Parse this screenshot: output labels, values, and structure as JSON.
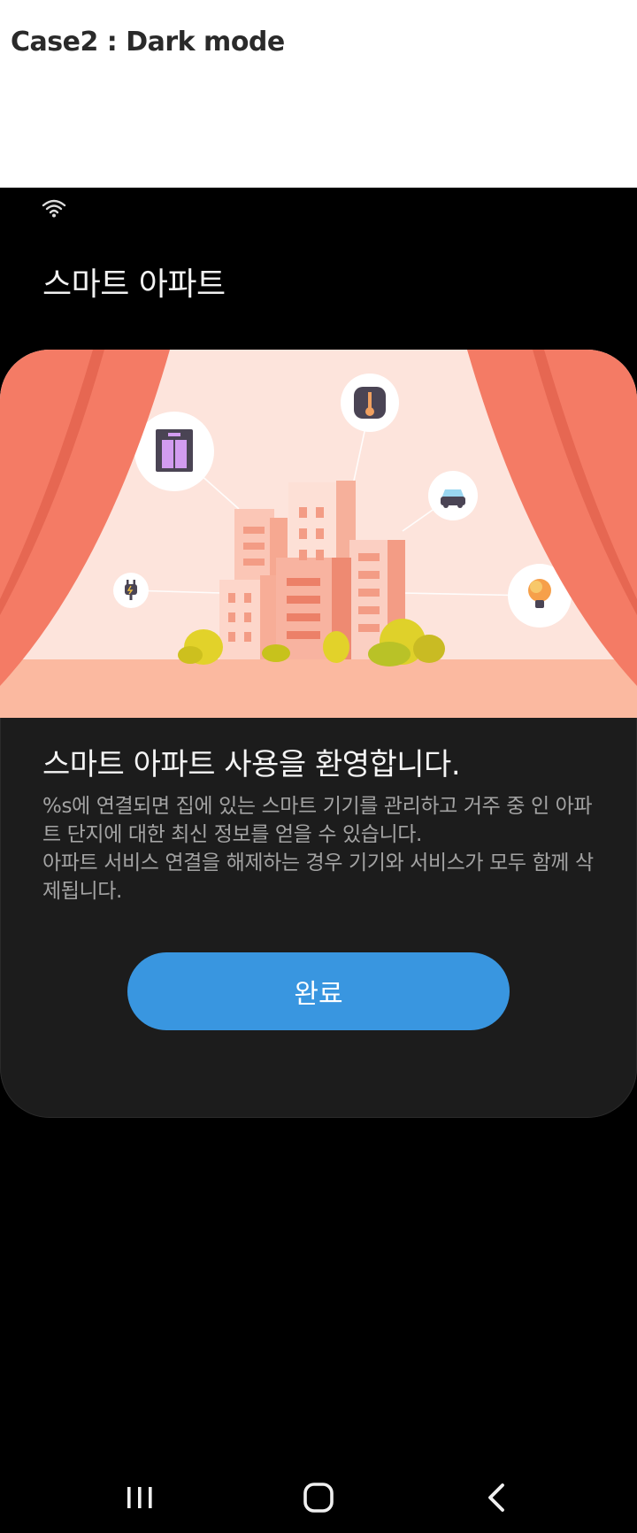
{
  "caption": "Case2 : Dark mode",
  "status_bar": {
    "wifi_icon": "wifi-icon"
  },
  "app": {
    "title": "스마트 아파트"
  },
  "card": {
    "title": "스마트 아파트 사용을 환영합니다.",
    "body_line1": " %s에 연결되면 집에 있는 스마트 기기를 관리하고 거주 중 인 아파트 단지에 대한 최신 정보를 얻을 수 있습니다.",
    "body_line2": "아파트 서비스 연결을 해제하는 경우 기기와 서비스가 모두 함께 삭제됩니다.",
    "illustration_icons": [
      "elevator-icon",
      "thermometer-icon",
      "car-icon",
      "plug-icon",
      "lightbulb-icon"
    ]
  },
  "done_button": {
    "label": "완료"
  },
  "nav": {
    "recents": "recents-icon",
    "home": "home-icon",
    "back": "back-icon"
  },
  "colors": {
    "accent": "#3996e0",
    "curtain": "#f47b65",
    "stage_floor": "#fbb9a0",
    "background": "#000000",
    "card": "#1c1c1c"
  }
}
